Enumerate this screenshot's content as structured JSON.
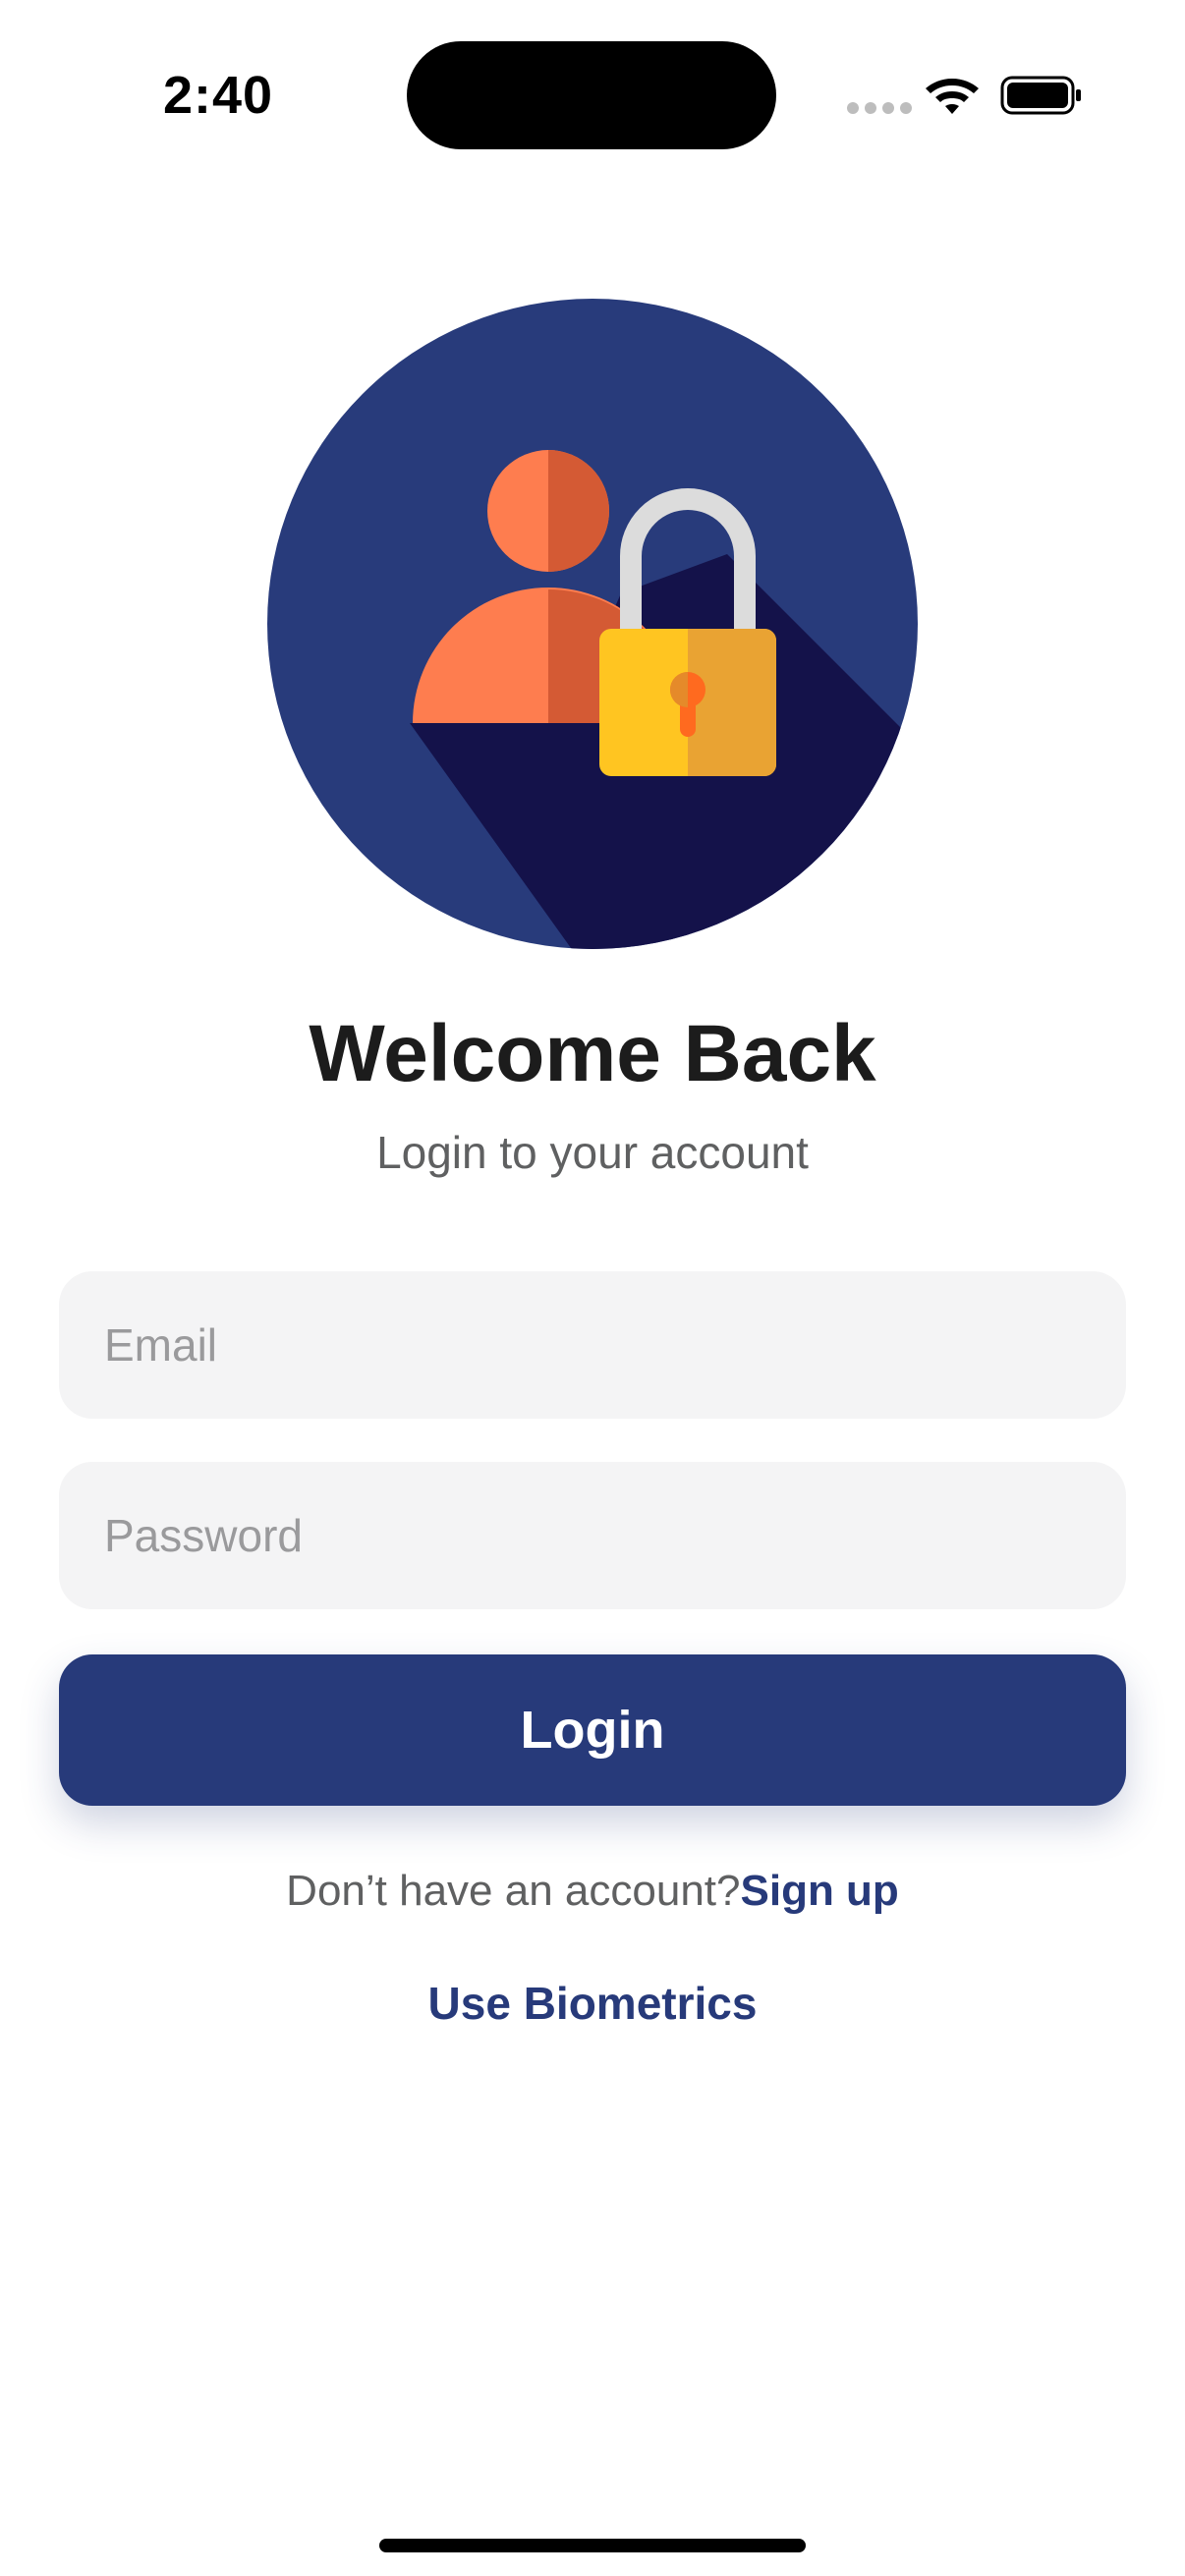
{
  "status_bar": {
    "time": "2:40"
  },
  "icons": {
    "wifi": "wifi-icon",
    "battery": "battery-icon",
    "hero": "user-lock-icon"
  },
  "colors": {
    "primary": "#273a7a",
    "field_background": "#f4f4f5",
    "hero_circle": "#283b7b",
    "hero_shadow": "#14124a",
    "person_orange": "#fe7d4f",
    "lock_yellow": "#ffc521"
  },
  "header": {
    "title": "Welcome Back",
    "subtitle": "Login to your account"
  },
  "form": {
    "email_placeholder": "Email",
    "password_placeholder": "Password",
    "login_label": "Login"
  },
  "footer": {
    "no_account_text": "Don’t have an account?",
    "signup_label": "Sign up",
    "biometrics_label": "Use Biometrics"
  }
}
